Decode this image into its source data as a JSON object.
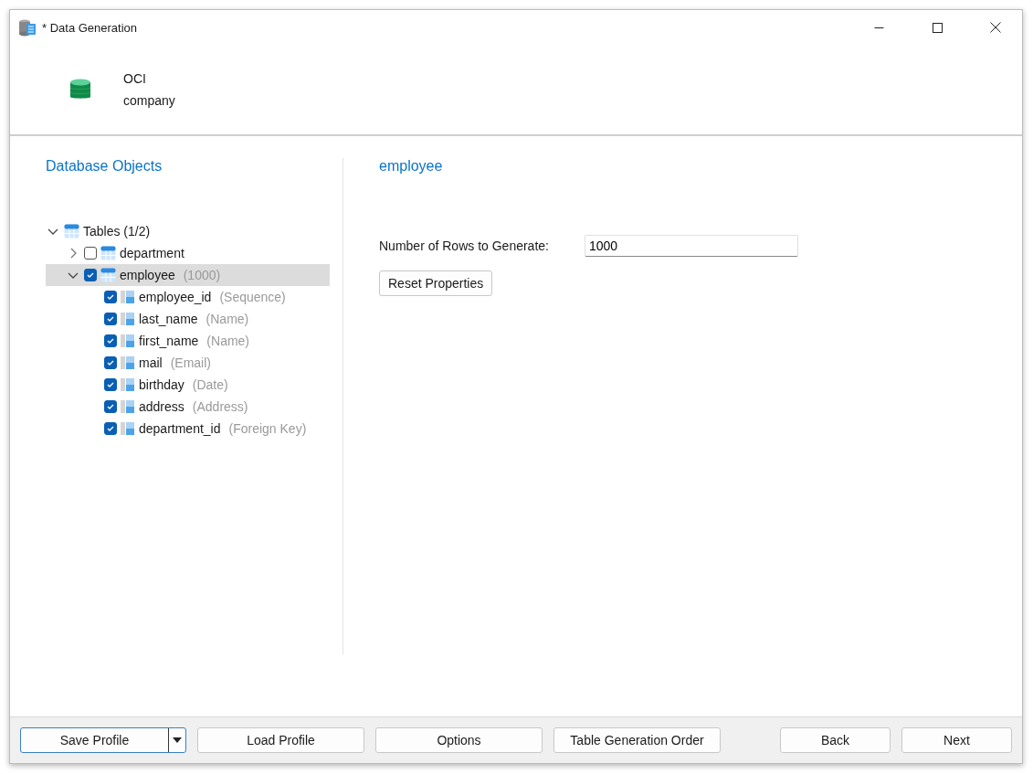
{
  "window": {
    "title": "* Data Generation"
  },
  "connection": {
    "name": "OCI",
    "database": "company"
  },
  "left_panel": {
    "heading": "Database Objects",
    "tree": [
      {
        "kind": "folder",
        "label": "Tables (1/2)",
        "expanded": true,
        "selected": false,
        "children": [
          {
            "kind": "table",
            "label": "department",
            "checked": false,
            "expanded": false,
            "selected": false
          },
          {
            "kind": "table",
            "label": "employee",
            "detail": "(1000)",
            "checked": true,
            "expanded": true,
            "selected": true,
            "children": [
              {
                "kind": "column",
                "label": "employee_id",
                "detail": "(Sequence)",
                "checked": true,
                "selected": false
              },
              {
                "kind": "column",
                "label": "last_name",
                "detail": "(Name)",
                "checked": true,
                "selected": false
              },
              {
                "kind": "column",
                "label": "first_name",
                "detail": "(Name)",
                "checked": true,
                "selected": false
              },
              {
                "kind": "column",
                "label": "mail",
                "detail": "(Email)",
                "checked": true,
                "selected": false
              },
              {
                "kind": "column",
                "label": "birthday",
                "detail": "(Date)",
                "checked": true,
                "selected": false
              },
              {
                "kind": "column",
                "label": "address",
                "detail": "(Address)",
                "checked": true,
                "selected": false
              },
              {
                "kind": "column",
                "label": "department_id",
                "detail": "(Foreign Key)",
                "checked": true,
                "selected": false
              }
            ]
          }
        ]
      }
    ]
  },
  "right_panel": {
    "heading": "employee",
    "rows_label": "Number of Rows to Generate:",
    "rows_value": "1000",
    "reset_button": "Reset Properties"
  },
  "footer": {
    "left_buttons": [
      "Save Profile",
      "Load Profile",
      "Options",
      "Table Generation Order"
    ],
    "right_buttons": [
      "Back",
      "Next"
    ]
  }
}
